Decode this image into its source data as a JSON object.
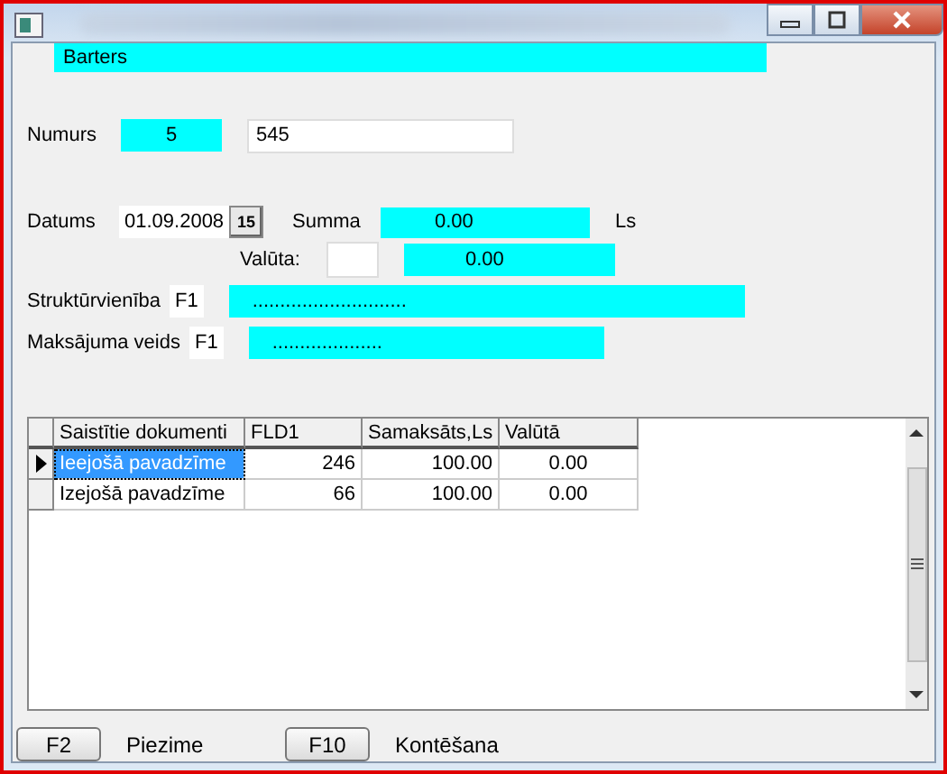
{
  "header": {
    "title": "Barters"
  },
  "numurs": {
    "label": "Numurs",
    "code": "5",
    "value": "545"
  },
  "datums": {
    "label": "Datums",
    "date": "01.09.2008",
    "calendar": "15",
    "summa_label": "Summa",
    "summa": "0.00",
    "currency": "Ls"
  },
  "valuta": {
    "label": "Valūta:",
    "value": "0.00"
  },
  "lookups": [
    {
      "label": "Struktūrvienība",
      "key": "F1",
      "value": "............................"
    },
    {
      "label": "Maksājuma veids",
      "key": "F1",
      "value": "...................."
    }
  ],
  "table": {
    "columns": [
      "Saistītie dokumenti",
      "FLD1",
      "Samaksāts,Ls",
      "Valūtā"
    ],
    "rows": [
      {
        "selected": true,
        "cells": [
          "Ieejošā pavadzīme",
          "246",
          "100.00",
          "0.00"
        ]
      },
      {
        "selected": false,
        "cells": [
          "Izejošā pavadzīme",
          "66",
          "100.00",
          "0.00"
        ]
      }
    ]
  },
  "actions": [
    {
      "key": "F2",
      "label": "Piezime"
    },
    {
      "key": "F10",
      "label": "Kontēšana"
    }
  ]
}
